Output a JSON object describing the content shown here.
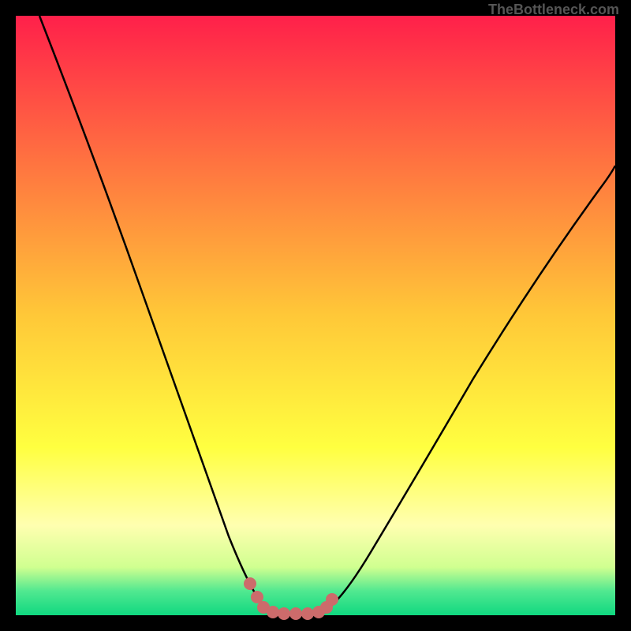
{
  "watermark": "TheBottleneck.com",
  "chart_data": {
    "type": "line",
    "title": "",
    "xlabel": "",
    "ylabel": "",
    "xlim": [
      0,
      100
    ],
    "ylim": [
      0,
      100
    ],
    "series": [
      {
        "name": "curve",
        "x": [
          5,
          10,
          15,
          20,
          25,
          30,
          35,
          38,
          40,
          42,
          45,
          48,
          50,
          55,
          60,
          65,
          70,
          75,
          80,
          85,
          90,
          95,
          100
        ],
        "y": [
          100,
          87,
          75,
          63,
          50,
          38,
          25,
          12,
          5,
          0,
          0,
          0,
          0,
          5,
          13,
          22,
          31,
          40,
          48,
          56,
          64,
          70,
          75
        ],
        "color": "#000000"
      },
      {
        "name": "bottom-markers",
        "x": [
          38,
          40,
          42,
          44,
          46,
          48,
          50,
          52
        ],
        "y": [
          3,
          1,
          0,
          0,
          0,
          0,
          1,
          3
        ],
        "color": "#cc6b6b",
        "type": "scatter"
      }
    ],
    "background_gradient": {
      "type": "vertical",
      "stops": [
        {
          "offset": 0,
          "color": "#ff204a"
        },
        {
          "offset": 0.25,
          "color": "#ff7540"
        },
        {
          "offset": 0.5,
          "color": "#ffc838"
        },
        {
          "offset": 0.72,
          "color": "#ffff40"
        },
        {
          "offset": 0.85,
          "color": "#ffffb0"
        },
        {
          "offset": 0.92,
          "color": "#d0ff90"
        },
        {
          "offset": 0.96,
          "color": "#50e890"
        },
        {
          "offset": 1.0,
          "color": "#10d880"
        }
      ]
    }
  }
}
